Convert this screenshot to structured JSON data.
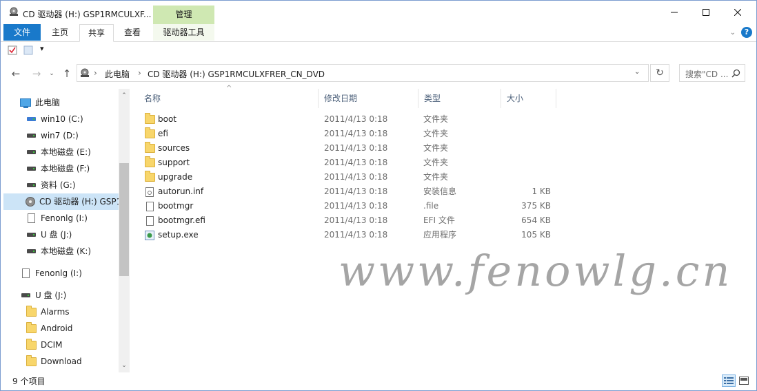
{
  "window": {
    "title": "CD 驱动器 (H:) GSP1RMCULXF...",
    "manage_tab": "管理"
  },
  "ribbon": {
    "tabs": [
      {
        "label": "文件"
      },
      {
        "label": "主页"
      },
      {
        "label": "共享"
      },
      {
        "label": "查看"
      },
      {
        "label": "驱动器工具"
      }
    ]
  },
  "address": {
    "segments": [
      "此电脑",
      "CD 驱动器 (H:) GSP1RMCULXFRER_CN_DVD"
    ],
    "search_placeholder": "搜索\"CD ..."
  },
  "nav": {
    "items": [
      {
        "label": "此电脑",
        "icon": "pc-icon"
      },
      {
        "label": "win10 (C:)",
        "icon": "windows-drive-icon"
      },
      {
        "label": "win7 (D:)",
        "icon": "drive-icon"
      },
      {
        "label": "本地磁盘 (E:)",
        "icon": "drive-icon"
      },
      {
        "label": "本地磁盘 (F:)",
        "icon": "drive-icon"
      },
      {
        "label": "资料 (G:)",
        "icon": "drive-icon"
      },
      {
        "label": "CD 驱动器 (H:) GSP1",
        "icon": "cd-drive-icon"
      },
      {
        "label": "Fenonlg (I:)",
        "icon": "document-icon"
      },
      {
        "label": "U 盘 (J:)",
        "icon": "drive-icon"
      },
      {
        "label": "本地磁盘 (K:)",
        "icon": "drive-icon"
      },
      {
        "label": "Fenonlg (I:)",
        "icon": "document-icon"
      },
      {
        "label": "U 盘 (J:)",
        "icon": "drive-icon"
      },
      {
        "label": "Alarms",
        "icon": "folder-icon"
      },
      {
        "label": "Android",
        "icon": "folder-icon"
      },
      {
        "label": "DCIM",
        "icon": "folder-icon"
      },
      {
        "label": "Download",
        "icon": "folder-icon"
      }
    ]
  },
  "columns": {
    "name": "名称",
    "date": "修改日期",
    "type": "类型",
    "size": "大小"
  },
  "files": [
    {
      "name": "boot",
      "date": "2011/4/13 0:18",
      "type": "文件夹",
      "size": "",
      "icon": "folder-icon"
    },
    {
      "name": "efi",
      "date": "2011/4/13 0:18",
      "type": "文件夹",
      "size": "",
      "icon": "folder-icon"
    },
    {
      "name": "sources",
      "date": "2011/4/13 0:18",
      "type": "文件夹",
      "size": "",
      "icon": "folder-icon"
    },
    {
      "name": "support",
      "date": "2011/4/13 0:18",
      "type": "文件夹",
      "size": "",
      "icon": "folder-icon"
    },
    {
      "name": "upgrade",
      "date": "2011/4/13 0:18",
      "type": "文件夹",
      "size": "",
      "icon": "folder-icon"
    },
    {
      "name": "autorun.inf",
      "date": "2011/4/13 0:18",
      "type": "安装信息",
      "size": "1 KB",
      "icon": "inf-file-icon"
    },
    {
      "name": "bootmgr",
      "date": "2011/4/13 0:18",
      "type": ".file",
      "size": "375 KB",
      "icon": "file-icon"
    },
    {
      "name": "bootmgr.efi",
      "date": "2011/4/13 0:18",
      "type": "EFI 文件",
      "size": "654 KB",
      "icon": "file-icon"
    },
    {
      "name": "setup.exe",
      "date": "2011/4/13 0:18",
      "type": "应用程序",
      "size": "105 KB",
      "icon": "exe-icon"
    }
  ],
  "watermark": "www.fenowlg.cn",
  "status": {
    "item_count": "9 个项目"
  },
  "colors": {
    "accent": "#1979ca",
    "manage_tab": "#cfe8b2",
    "selection": "#cce4f7"
  }
}
